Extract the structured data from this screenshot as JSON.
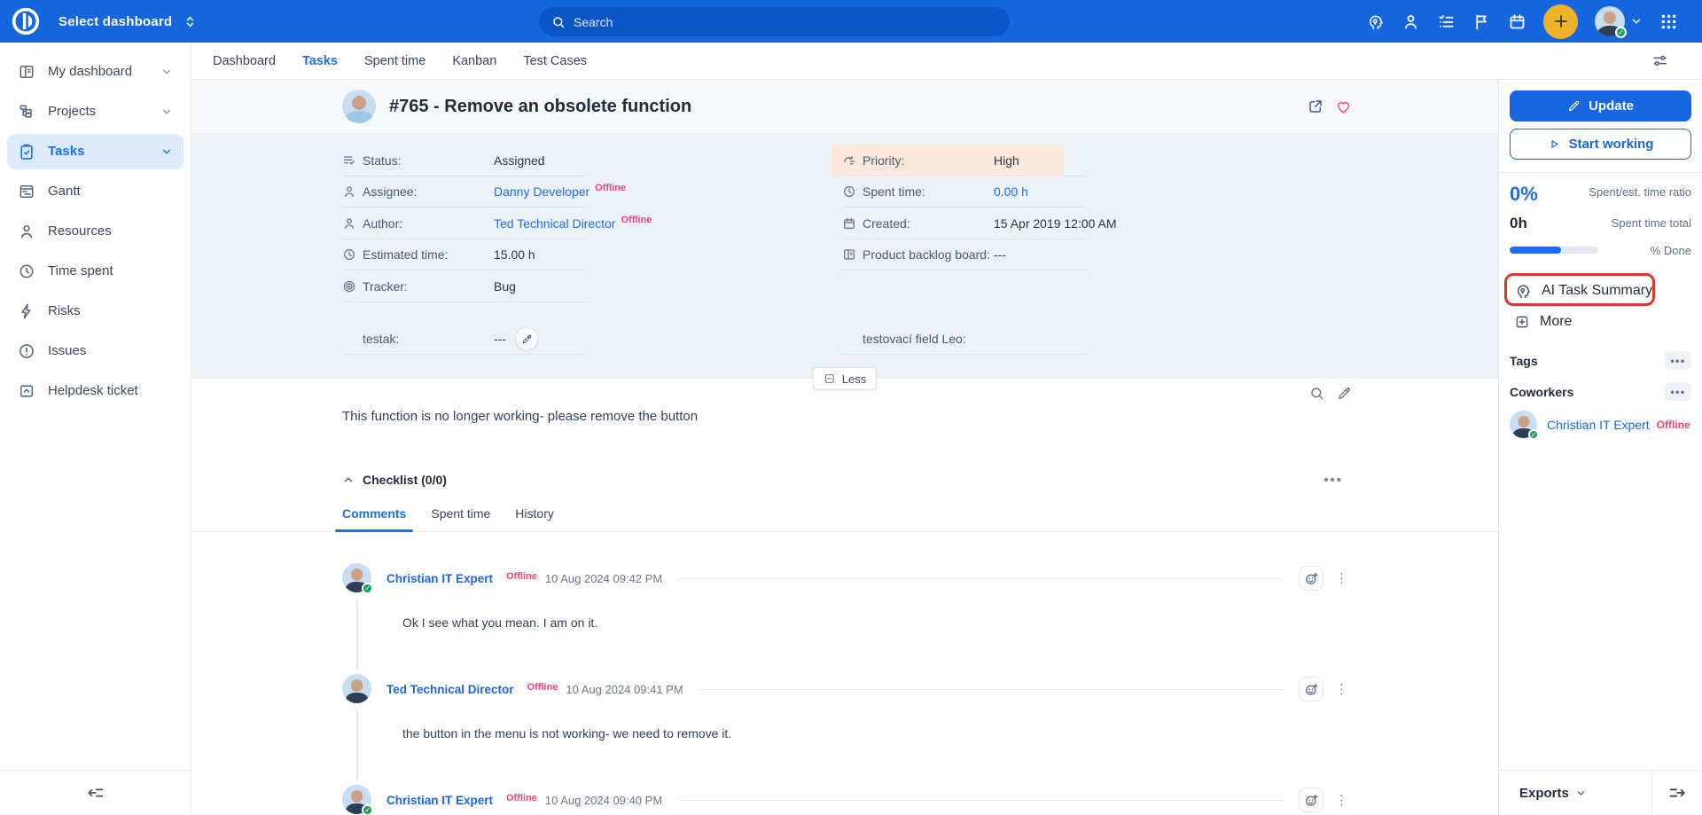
{
  "colors": {
    "topbar_blue": "#1666e0",
    "accent_blue": "#1a6fe9",
    "link_blue": "#1d6fe8",
    "offline_pink": "#f1447c",
    "priority_highlight": "#fce8da",
    "quickadd_yellow": "#efb32a",
    "annotation_red": "#db382b",
    "details_bg": "#edf2f8"
  },
  "topbar": {
    "dashboard_selector": "Select dashboard",
    "search": {
      "placeholder": "Search"
    },
    "icon_names": [
      "ai-assistant-icon",
      "users-icon",
      "my-tasks-icon",
      "flag-icon",
      "calendar-icon",
      "quick-add-plus-icon",
      "user-avatar",
      "chevron-down-icon",
      "apps-grid-icon"
    ]
  },
  "sidebar": {
    "items": [
      {
        "label": "My dashboard",
        "icon": "dashboard-icon",
        "chevron": true
      },
      {
        "label": "Projects",
        "icon": "projects-tree-icon",
        "chevron": true
      },
      {
        "label": "Tasks",
        "icon": "clipboard-check-icon",
        "chevron": true,
        "active": true
      },
      {
        "label": "Gantt",
        "icon": "gantt-icon"
      },
      {
        "label": "Resources",
        "icon": "person-icon"
      },
      {
        "label": "Time spent",
        "icon": "clock-icon"
      },
      {
        "label": "Risks",
        "icon": "lightning-icon"
      },
      {
        "label": "Issues",
        "icon": "alert-circle-icon"
      },
      {
        "label": "Helpdesk ticket",
        "icon": "helpdesk-icon"
      }
    ]
  },
  "project_nav": {
    "tabs": [
      {
        "label": "Dashboard"
      },
      {
        "label": "Tasks",
        "active": true
      },
      {
        "label": "Spent time"
      },
      {
        "label": "Kanban"
      },
      {
        "label": "Test Cases"
      }
    ]
  },
  "task": {
    "title": "#765 - Remove an obsolete function",
    "details": {
      "left": [
        {
          "icon": "status-list-icon",
          "label": "Status:",
          "value": "Assigned"
        },
        {
          "icon": "person-icon",
          "label": "Assignee:",
          "value": "Danny Developer",
          "presence": "Offline"
        },
        {
          "icon": "person-icon",
          "label": "Author:",
          "value": "Ted Technical Director",
          "presence": "Offline"
        },
        {
          "icon": "clock-icon",
          "label": "Estimated time:",
          "value": "15.00 h"
        },
        {
          "icon": "target-icon",
          "label": "Tracker:",
          "value": "Bug"
        }
      ],
      "right": [
        {
          "icon": "priority-icon",
          "label": "Priority:",
          "value": "High",
          "highlighted": true
        },
        {
          "icon": "clock-icon",
          "label": "Spent time:",
          "value": "0.00 h"
        },
        {
          "icon": "calendar-icon",
          "label": "Created:",
          "value": "15 Apr 2019 12:00 AM"
        },
        {
          "icon": "board-icon",
          "label": "Product backlog board:",
          "value": "---"
        }
      ],
      "custom_left": {
        "label": "testak:",
        "value": "---"
      },
      "custom_right": {
        "label": "testovací field Leo:"
      },
      "less_button": "Less"
    },
    "description": "This function is no longer working- please remove the button",
    "checklist": {
      "label": "Checklist (0/0)"
    },
    "activity_tabs": [
      {
        "label": "Comments",
        "active": true
      },
      {
        "label": "Spent time"
      },
      {
        "label": "History"
      }
    ],
    "comments": [
      {
        "author": "Christian IT Expert",
        "presence": "Offline",
        "time": "10 Aug 2024 09:42 PM",
        "text": "Ok I see what you mean. I am on it."
      },
      {
        "author": "Ted Technical Director",
        "presence": "Offline",
        "time": "10 Aug 2024 09:41 PM",
        "text": "the button in the menu is not working- we need to remove it."
      },
      {
        "author": "Christian IT Expert",
        "presence": "Offline",
        "time": "10 Aug 2024 09:40 PM",
        "text": ""
      }
    ]
  },
  "right_panel": {
    "update_button": "Update",
    "start_working_button": "Start working",
    "stats": {
      "spent_est_ratio_value": "0%",
      "spent_est_ratio_label": "Spent/est. time ratio",
      "spent_total_value": "0h",
      "spent_total_label": "Spent time total",
      "done_label": "% Done",
      "done_percent": 58
    },
    "ai_task_summary": "AI Task Summary",
    "more": "More",
    "tags_header": "Tags",
    "coworkers_header": "Coworkers",
    "coworker": {
      "name": "Christian IT Expert",
      "presence": "Offline"
    },
    "exports": "Exports"
  }
}
